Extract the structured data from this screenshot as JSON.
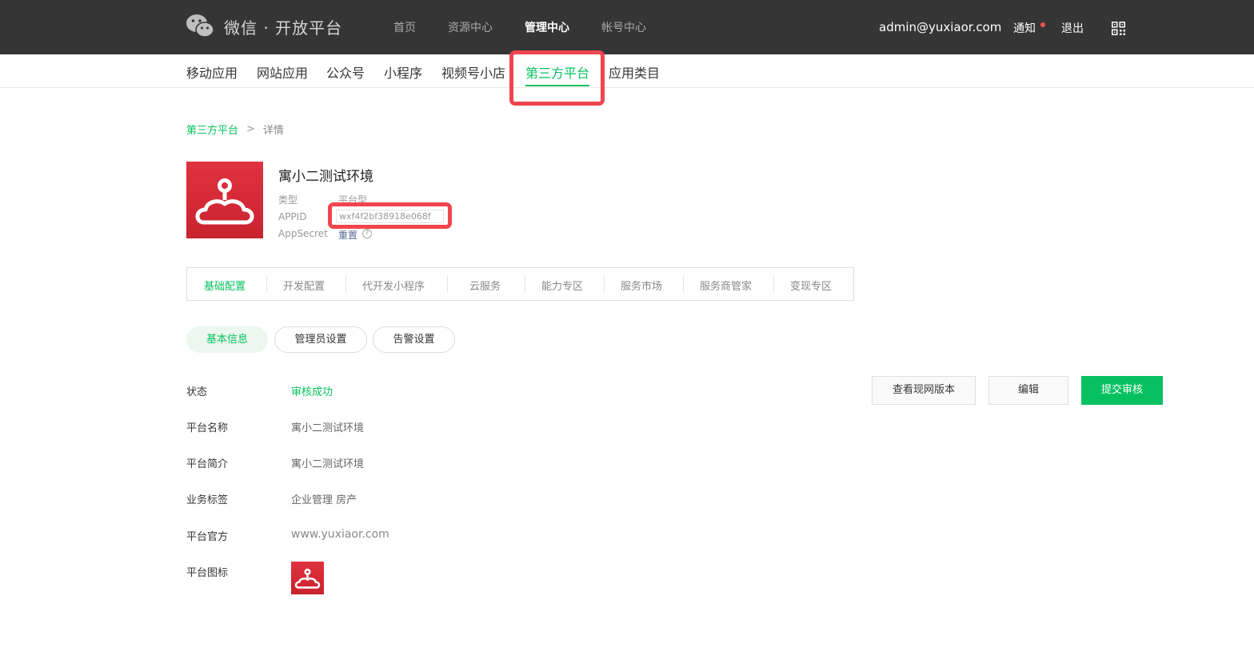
{
  "header": {
    "brand": "微信 · 开放平台",
    "nav": [
      "首页",
      "资源中心",
      "管理中心",
      "帐号中心"
    ],
    "active_nav": "管理中心",
    "user_email": "admin@yuxiaor.com",
    "notice_label": "通知",
    "logout_label": "退出"
  },
  "subnav": {
    "items": [
      "移动应用",
      "网站应用",
      "公众号",
      "小程序",
      "视频号小店",
      "第三方平台",
      "应用类目"
    ],
    "active": "第三方平台"
  },
  "breadcrumb": {
    "parent": "第三方平台",
    "separator": ">",
    "current": "详情"
  },
  "app": {
    "name": "寓小二测试环境",
    "type_label": "类型",
    "type_value": "平台型",
    "appid_label": "APPID",
    "appid_value": "wxf4f2bf38918e068f",
    "secret_label": "AppSecret",
    "secret_action": "重置",
    "help_icon": "?"
  },
  "tabs": [
    "基础配置",
    "开发配置",
    "代开发小程序",
    "云服务",
    "能力专区",
    "服务市场",
    "服务商管家",
    "变现专区"
  ],
  "active_tab": "基础配置",
  "subtabs": [
    "基本信息",
    "管理员设置",
    "告警设置"
  ],
  "active_subtab": "基本信息",
  "info": {
    "status_label": "状态",
    "status_value": "审核成功",
    "name_label": "平台名称",
    "name_value": "寓小二测试环境",
    "intro_label": "平台简介",
    "intro_value": "寓小二测试环境",
    "tags_label": "业务标签",
    "tags_value": "企业管理 房产",
    "site_label": "平台官方",
    "site_value": "www.yuxiaor.com",
    "icon_label": "平台图标"
  },
  "actions": {
    "view_label": "查看现网版本",
    "edit_label": "编辑",
    "submit_label": "提交审核"
  },
  "colors": {
    "accent": "#07c160",
    "header_bg": "#353535",
    "highlight": "#f0454e",
    "app_red": "#d42b38"
  }
}
